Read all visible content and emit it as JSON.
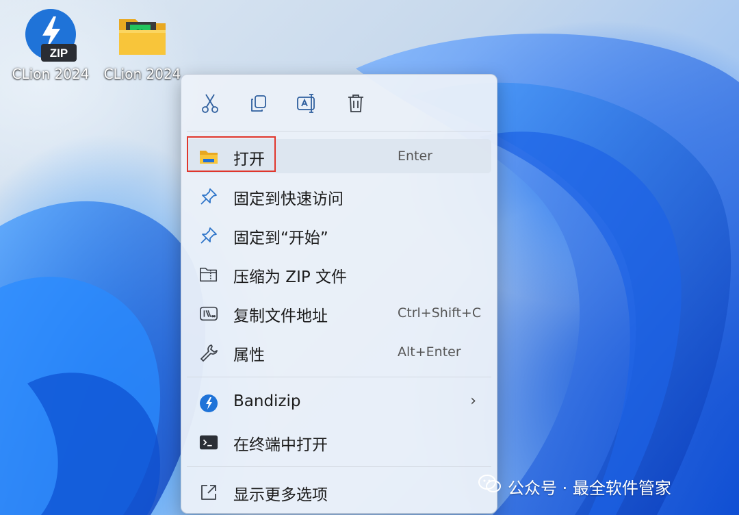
{
  "desktop": {
    "icons": [
      {
        "label": "CLion 2024",
        "icon": "bandizip-zip-icon"
      },
      {
        "label": "CLion 2024",
        "icon": "folder-icon"
      }
    ]
  },
  "context_menu": {
    "toolbar": [
      {
        "name": "cut",
        "icon": "scissors-icon"
      },
      {
        "name": "copy",
        "icon": "copy-icon"
      },
      {
        "name": "rename",
        "icon": "rename-icon"
      },
      {
        "name": "delete",
        "icon": "trash-icon"
      }
    ],
    "items": [
      {
        "label": "打开",
        "shortcut": "Enter",
        "icon": "folder-icon"
      },
      {
        "label": "固定到快速访问",
        "shortcut": "",
        "icon": "pin-icon"
      },
      {
        "label": "固定到“开始”",
        "shortcut": "",
        "icon": "pin-icon"
      },
      {
        "label": "压缩为 ZIP 文件",
        "shortcut": "",
        "icon": "zip-folder-icon"
      },
      {
        "label": "复制文件地址",
        "shortcut": "Ctrl+Shift+C",
        "icon": "path-icon"
      },
      {
        "label": "属性",
        "shortcut": "Alt+Enter",
        "icon": "wrench-icon"
      },
      {
        "label": "Bandizip",
        "shortcut": "",
        "icon": "bandizip-icon",
        "submenu": "›"
      },
      {
        "label": "在终端中打开",
        "shortcut": "",
        "icon": "terminal-icon"
      },
      {
        "label": "显示更多选项",
        "shortcut": "",
        "icon": "more-options-icon"
      }
    ]
  },
  "watermark": {
    "text": "公众号 · 最全软件管家"
  },
  "colors": {
    "accent": "#0067c0",
    "highlight_border": "#e0362c",
    "folder_yellow": "#f8c53a"
  }
}
